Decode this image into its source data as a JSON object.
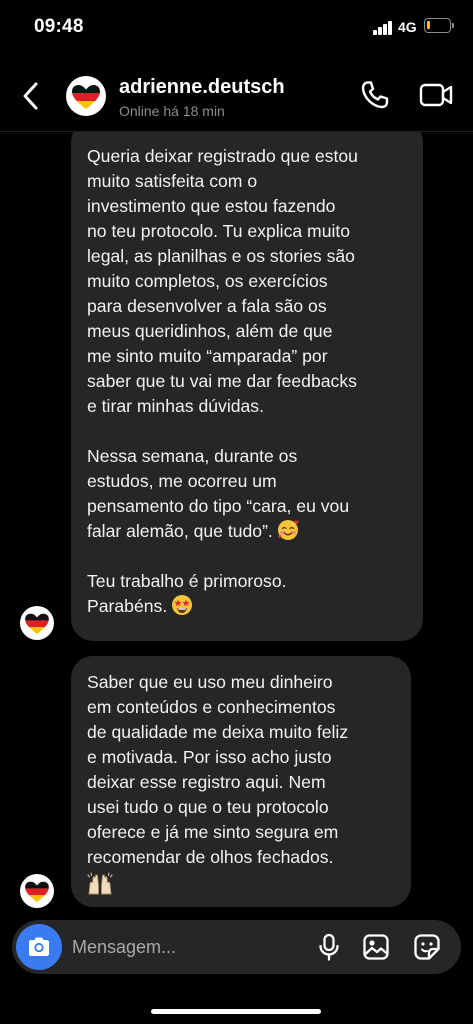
{
  "status_bar": {
    "time": "09:48",
    "network": "4G",
    "battery_level": 0.15,
    "battery_color": "#f5c400"
  },
  "header": {
    "name": "adrienne.deutsch",
    "status": "Online há 18 min",
    "icons": [
      "chevron-left-icon",
      "phone-icon",
      "video-camera-icon"
    ]
  },
  "messages": [
    {
      "paragraphs": [
        "Queria deixar registrado que estou\nmuito satisfeita com o\ninvestimento que estou fazendo\nno teu protocolo. Tu explica muito\nlegal, as planilhas e os stories são\nmuito completos, os exercícios\npara desenvolver a fala são os\nmeus queridinhos, além de que\nme sinto muito “amparada” por\nsaber que tu vai me dar feedbacks\ne tirar minhas dúvidas.",
        "Nessa semana, durante os\nestudos, me ocorreu um\npensamento do tipo “cara, eu vou\nfalar alemão, que tudo”.",
        "Teu trabalho é primoroso.\nParabéns."
      ],
      "emojis": [
        "smiling-face-with-hearts-emoji",
        "star-struck-emoji"
      ]
    },
    {
      "paragraphs": [
        "Saber que eu uso meu dinheiro\nem conteúdos e conhecimentos\nde qualidade me deixa muito feliz\ne motivada. Por isso acho justo\ndeixar esse registro aqui. Nem\nusei tudo o que o teu protocolo\noferece e já me sinto segura em\nrecomendar de olhos fechados."
      ],
      "emojis": [
        "raising-hands-emoji"
      ]
    }
  ],
  "composer": {
    "placeholder": "Mensagem...",
    "icons": [
      "camera-icon",
      "microphone-icon",
      "gallery-icon",
      "sticker-icon"
    ],
    "camera_color": "#3a7bf2"
  },
  "colors": {
    "background": "#000000",
    "bubble": "#262626",
    "muted_text": "#8e8e8e"
  }
}
